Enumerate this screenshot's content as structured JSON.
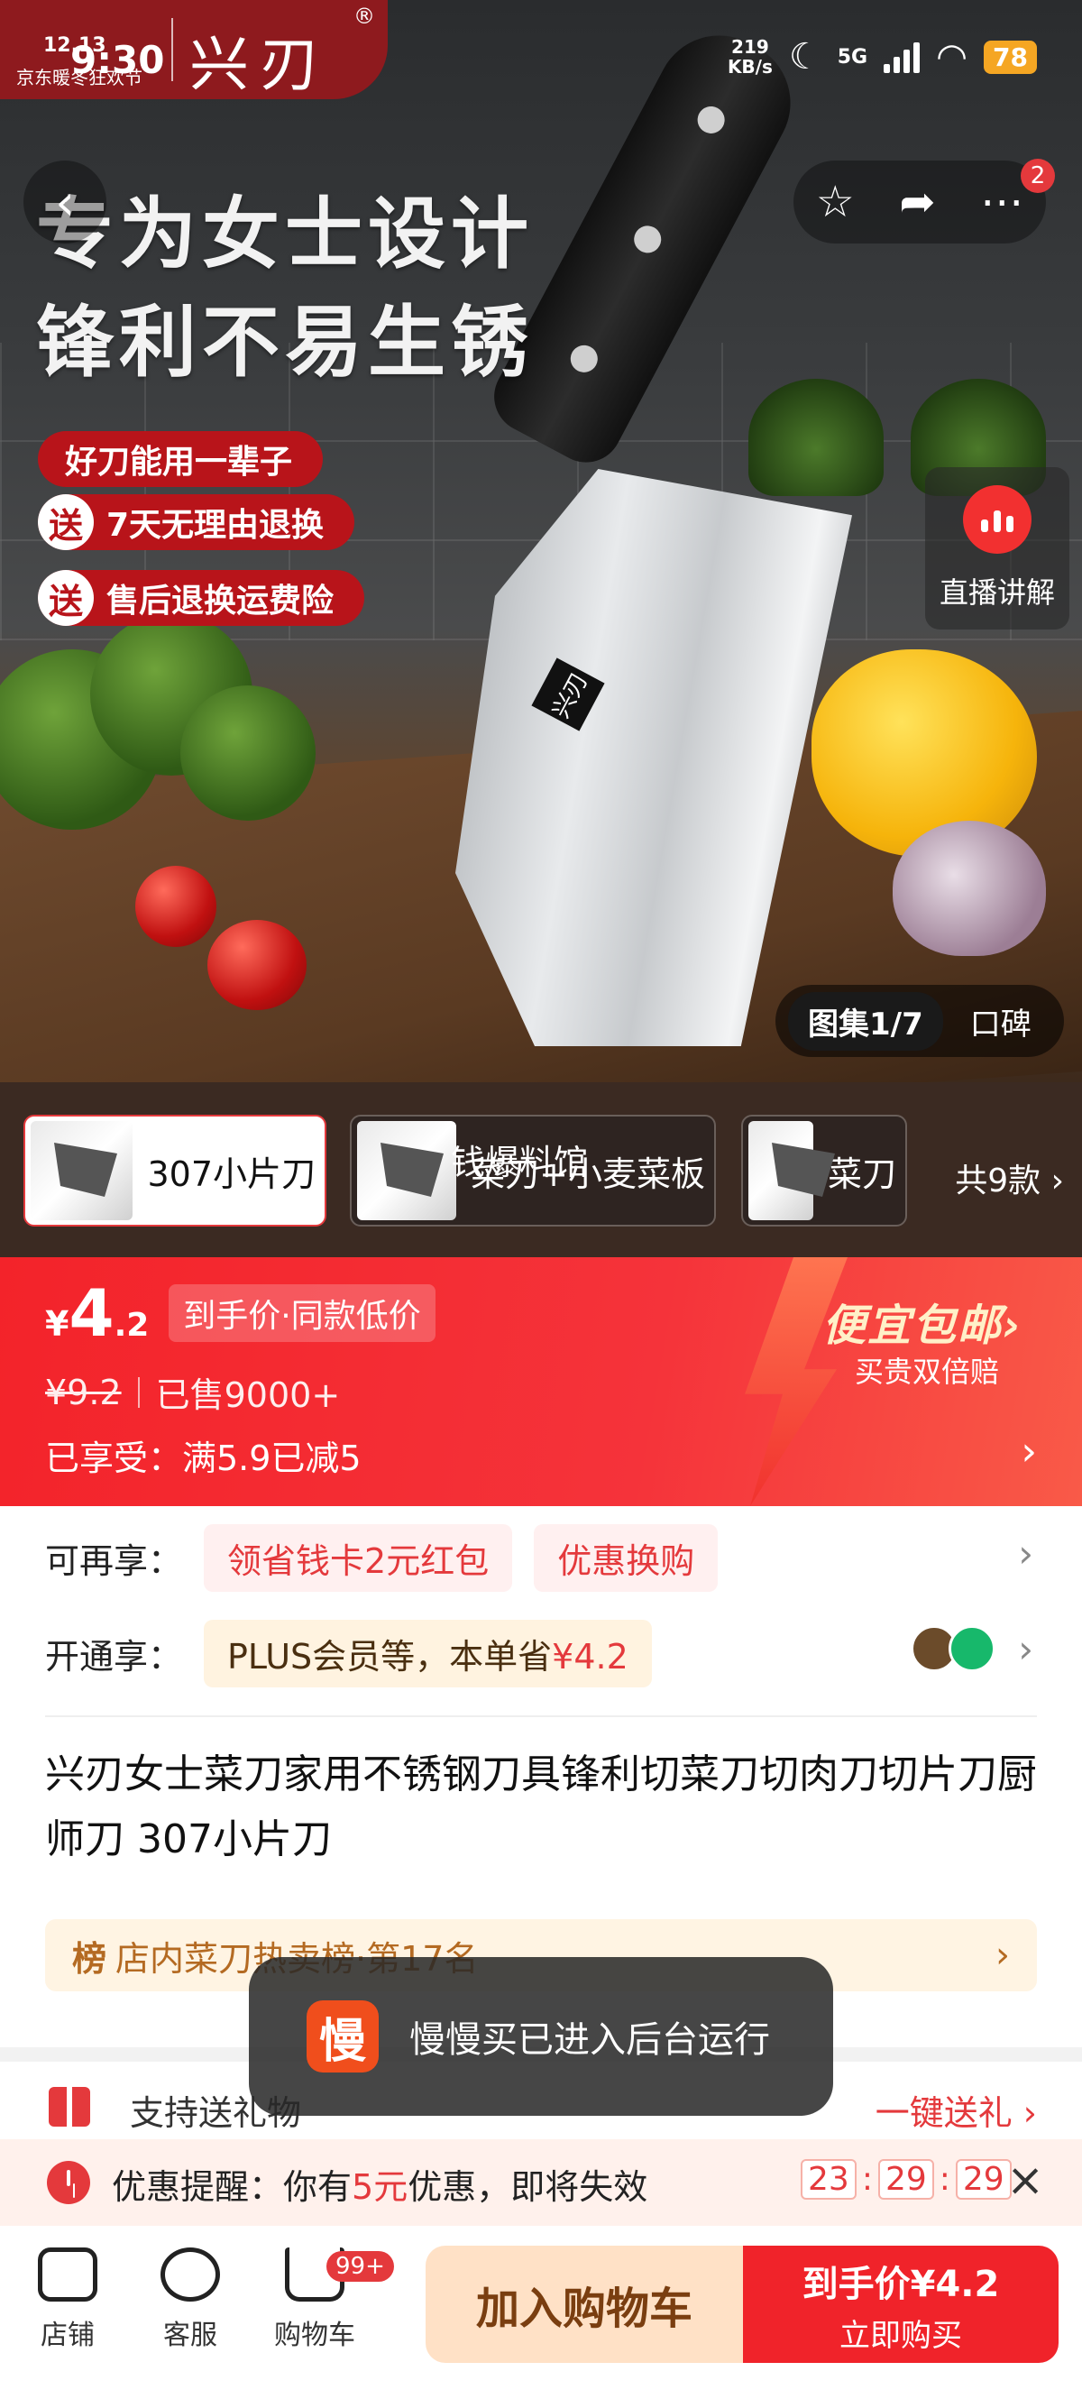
{
  "status_bar": {
    "time": "9:30",
    "net_speed_value": "219",
    "net_speed_unit": "KB/s",
    "signal": "5G",
    "battery": "78"
  },
  "brand": {
    "logo": "兴刃",
    "reg_mark": "®",
    "sale_date": "12.13",
    "sale_name": "京东暖冬狂欢节"
  },
  "nav": {
    "back_icon": "chevron-left-icon",
    "notif_count": "2"
  },
  "hero": {
    "headline_1": "专为女士设计",
    "headline_2": "锋利不易生锈",
    "promo_1": "好刀能用一辈子",
    "promo_2_prefix": "送",
    "promo_2": "7天无理由退换",
    "promo_3_prefix": "送",
    "promo_3": "售后退换运费险",
    "knife_stamp": "兴刃",
    "live_label": "直播讲解",
    "gallery_tab_active": "图集1/7",
    "gallery_tab_other": "口碑"
  },
  "sku": {
    "items": [
      {
        "name": "307小片刀"
      },
      {
        "name": "菜刀+小麦菜板"
      },
      {
        "name": "菜刀"
      }
    ],
    "overlay_text": "钱爆料馆",
    "more_label": "共9款 ›"
  },
  "price": {
    "currency": "¥",
    "int": "4",
    "dec": ".2",
    "tag": "到手价·同款低价",
    "original": "¥9.2",
    "sold": "已售9000+",
    "enjoy": "已享受：满5.9已减5",
    "cheap_title": "便宜包邮›",
    "cheap_sub": "买贵双倍赔"
  },
  "offers": {
    "row1_label": "可再享：",
    "row1_chip1": "领省钱卡2元红包",
    "row1_chip2": "优惠换购",
    "row2_label": "开通享：",
    "row2_chip_text": "PLUS会员等，本单省",
    "row2_chip_amount": "¥4.2"
  },
  "product_title": "兴刃女士菜刀家用不锈钢刀具锋利切菜刀切肉刀切片刀厨师刀 307小片刀",
  "rank": {
    "badge": "榜",
    "text": "店内菜刀热卖榜·第17名"
  },
  "gift": {
    "text": "支持送礼物",
    "action": "一键送礼 ›"
  },
  "toast": {
    "icon_char": "慢",
    "text": "慢慢买已进入后台运行"
  },
  "reminder": {
    "prefix": "优惠提醒：你有",
    "amount": "5元",
    "suffix": "优惠，即将失效",
    "hh": "23",
    "mm": "29",
    "ss": "29"
  },
  "bottom": {
    "store": "店铺",
    "service": "客服",
    "cart": "购物车",
    "cart_badge": "99+",
    "add_cart": "加入购物车",
    "buy_line1": "到手价¥4.2",
    "buy_line2": "立即购买"
  },
  "colors": {
    "accent": "#e4393c",
    "price_band": "#f3232a",
    "brand_red": "#8e1a1e"
  }
}
